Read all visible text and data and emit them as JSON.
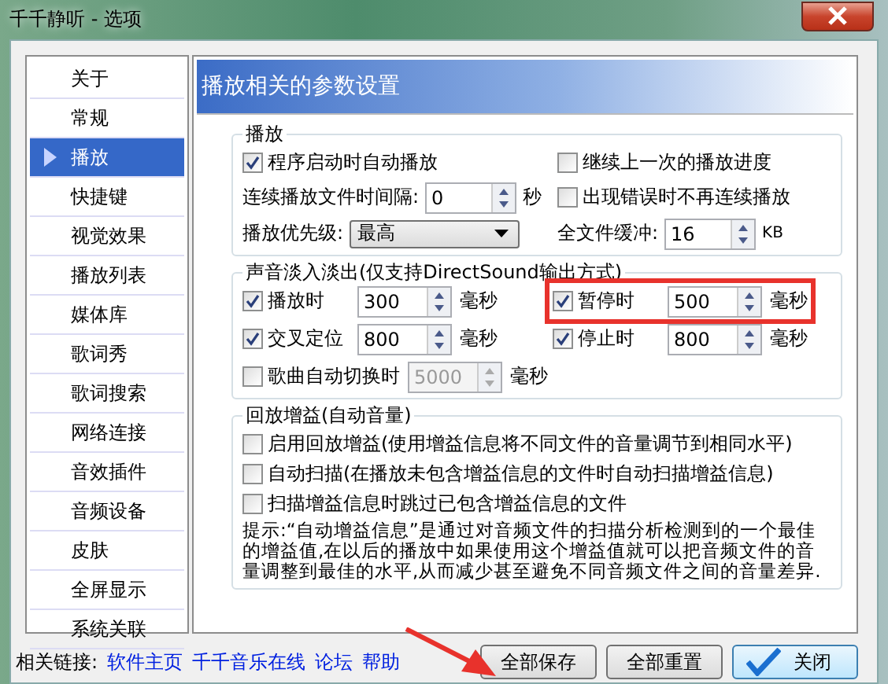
{
  "window": {
    "title": "千千静听 - 选项"
  },
  "sidebar": {
    "items": [
      {
        "label": "关于",
        "selected": false
      },
      {
        "label": "常规",
        "selected": false
      },
      {
        "label": "播放",
        "selected": true
      },
      {
        "label": "快捷键",
        "selected": false
      },
      {
        "label": "视觉效果",
        "selected": false
      },
      {
        "label": "播放列表",
        "selected": false
      },
      {
        "label": "媒体库",
        "selected": false
      },
      {
        "label": "歌词秀",
        "selected": false
      },
      {
        "label": "歌词搜索",
        "selected": false
      },
      {
        "label": "网络连接",
        "selected": false
      },
      {
        "label": "音效插件",
        "selected": false
      },
      {
        "label": "音频设备",
        "selected": false
      },
      {
        "label": "皮肤",
        "selected": false
      },
      {
        "label": "全屏显示",
        "selected": false
      },
      {
        "label": "系统关联",
        "selected": false
      }
    ]
  },
  "panel": {
    "header": "播放相关的参数设置",
    "playback": {
      "title": "播放",
      "auto_play": {
        "label": "程序启动时自动播放",
        "checked": true
      },
      "resume": {
        "label": "继续上一次的播放进度",
        "checked": false
      },
      "interval": {
        "label": "连续播放文件时间隔:",
        "value": "0",
        "unit": "秒"
      },
      "stop_on_error": {
        "label": "出现错误时不再连续播放",
        "checked": false
      },
      "priority": {
        "label": "播放优先级:",
        "value": "最高"
      },
      "buffer": {
        "label": "全文件缓冲:",
        "value": "16",
        "unit": "KB"
      }
    },
    "fade": {
      "title": "声音淡入淡出(仅支持DirectSound输出方式)",
      "items": [
        {
          "label": "播放时",
          "checked": true,
          "value": "300",
          "unit": "毫秒",
          "disabled": false,
          "highlighted": false
        },
        {
          "label": "暂停时",
          "checked": true,
          "value": "500",
          "unit": "毫秒",
          "disabled": false,
          "highlighted": true
        },
        {
          "label": "交叉定位",
          "checked": true,
          "value": "800",
          "unit": "毫秒",
          "disabled": false,
          "highlighted": false
        },
        {
          "label": "停止时",
          "checked": true,
          "value": "800",
          "unit": "毫秒",
          "disabled": false,
          "highlighted": false
        },
        {
          "label": "歌曲自动切换时",
          "checked": false,
          "value": "5000",
          "unit": "毫秒",
          "disabled": true,
          "highlighted": false
        }
      ]
    },
    "gain": {
      "title": "回放增益(自动音量)",
      "options": [
        {
          "label": "启用回放增益(使用增益信息将不同文件的音量调节到相同水平)",
          "checked": false
        },
        {
          "label": "自动扫描(在播放未包含增益信息的文件时自动扫描增益信息)",
          "checked": false
        },
        {
          "label": "扫描增益信息时跳过已包含增益信息的文件",
          "checked": false
        }
      ],
      "hint": "提示:“自动增益信息”是通过对音频文件的扫描分析检测到的一个最佳的增益值,在以后的播放中如果使用这个增益值就可以把音频文件的音量调整到最佳的水平,从而减少甚至避免不同音频文件之间的音量差异."
    }
  },
  "footer": {
    "links_label": "相关链接:",
    "links": [
      "软件主页",
      "千千音乐在线",
      "论坛",
      "帮助"
    ],
    "buttons": [
      {
        "label": "全部保存",
        "kind": "plain"
      },
      {
        "label": "全部重置",
        "kind": "plain"
      },
      {
        "label": "关闭",
        "kind": "confirm"
      }
    ]
  }
}
